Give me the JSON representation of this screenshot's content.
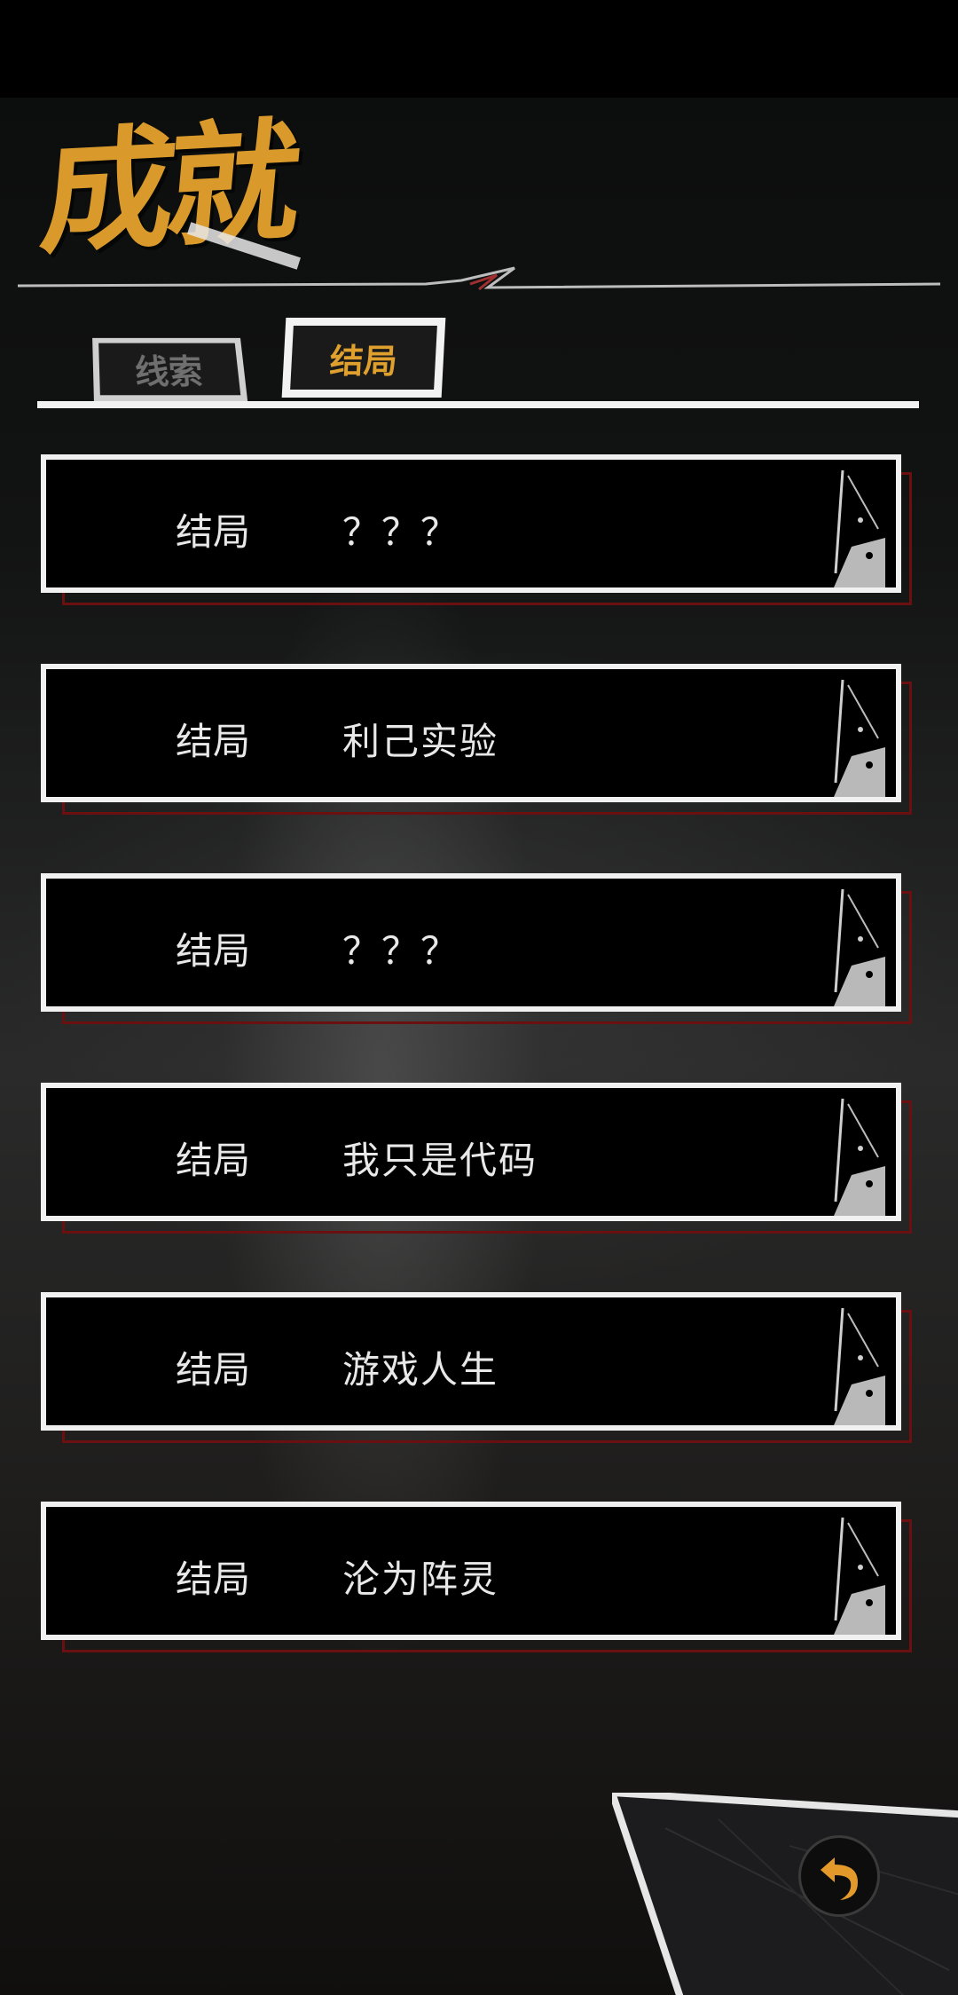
{
  "header": {
    "title": "成就"
  },
  "tabs": [
    {
      "label": "线索",
      "active": false
    },
    {
      "label": "结局",
      "active": true
    }
  ],
  "endings": [
    {
      "label": "结局",
      "name": "？？？"
    },
    {
      "label": "结局",
      "name": "利己实验"
    },
    {
      "label": "结局",
      "name": "？？？"
    },
    {
      "label": "结局",
      "name": "我只是代码"
    },
    {
      "label": "结局",
      "name": "游戏人生"
    },
    {
      "label": "结局",
      "name": "沦为阵灵"
    }
  ],
  "icons": {
    "back": "back-arrow-icon"
  },
  "colors": {
    "accent": "#d99a2b",
    "card_border": "#f1f1f1",
    "card_shadow": "#6b1010",
    "inactive_tab_text": "#6f6f6f"
  }
}
